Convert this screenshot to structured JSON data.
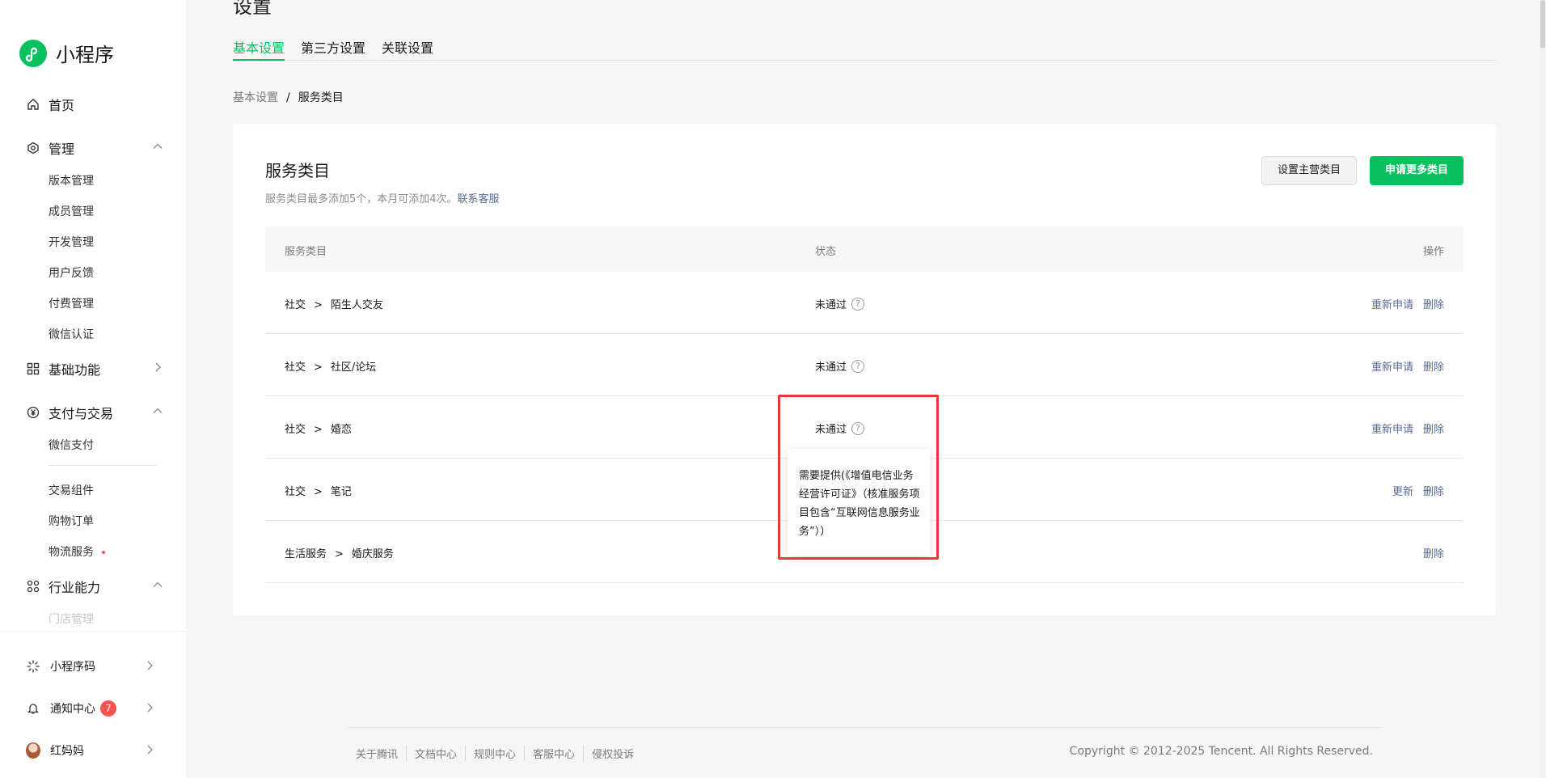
{
  "sidebar": {
    "brand": "小程序",
    "home": "首页",
    "manage": {
      "label": "管理",
      "items": [
        "版本管理",
        "成员管理",
        "开发管理",
        "用户反馈",
        "付费管理",
        "微信认证"
      ]
    },
    "basic": "基础功能",
    "pay": {
      "label": "支付与交易",
      "items": [
        "微信支付",
        "交易组件",
        "购物订单",
        "物流服务"
      ]
    },
    "industry": {
      "label": "行业能力",
      "items": [
        "门店管理"
      ]
    },
    "bottom": {
      "qrcode": "小程序码",
      "notify": "通知中心",
      "notify_count": "7",
      "user": "红妈妈"
    }
  },
  "header": {
    "title": "设置",
    "tabs": [
      "基本设置",
      "第三方设置",
      "关联设置"
    ],
    "active_tab": "基本设置"
  },
  "breadcrumb": {
    "parent": "基本设置",
    "sep": "/",
    "current": "服务类目"
  },
  "card": {
    "title": "服务类目",
    "subtitle": "服务类目最多添加5个，本月可添加4次。",
    "contact": "联系客服",
    "btn_set_main": "设置主营类目",
    "btn_apply_more": "申请更多类目"
  },
  "table": {
    "headers": {
      "category": "服务类目",
      "status": "状态",
      "ops": "操作"
    },
    "rows": [
      {
        "parent": "社交",
        "gt": ">",
        "child": "陌生人交友",
        "status": "未通过",
        "ops": [
          "重新申请",
          "删除"
        ]
      },
      {
        "parent": "社交",
        "gt": ">",
        "child": "社区/论坛",
        "status": "未通过",
        "ops": [
          "重新申请",
          "删除"
        ]
      },
      {
        "parent": "社交",
        "gt": ">",
        "child": "婚恋",
        "status": "未通过",
        "ops": [
          "重新申请",
          "删除"
        ]
      },
      {
        "parent": "社交",
        "gt": ">",
        "child": "笔记",
        "status": "",
        "ops": [
          "更新",
          "删除"
        ]
      },
      {
        "parent": "生活服务",
        "gt": ">",
        "child": "婚庆服务",
        "status": "",
        "ops": [
          "删除"
        ]
      }
    ],
    "question_mark": "?"
  },
  "tooltip": {
    "text": "需要提供(《增值电信业务经营许可证》（核准服务项目包含“互联网信息服务业务”））"
  },
  "footer": {
    "links": [
      "关于腾讯",
      "文档中心",
      "规则中心",
      "客服中心",
      "侵权投诉"
    ],
    "copyright": "Copyright © 2012-2025 Tencent. All Rights Reserved."
  },
  "colors": {
    "accent": "#07c160",
    "link": "#576b95",
    "danger": "#fa5151",
    "highlight_border": "#e53935"
  }
}
